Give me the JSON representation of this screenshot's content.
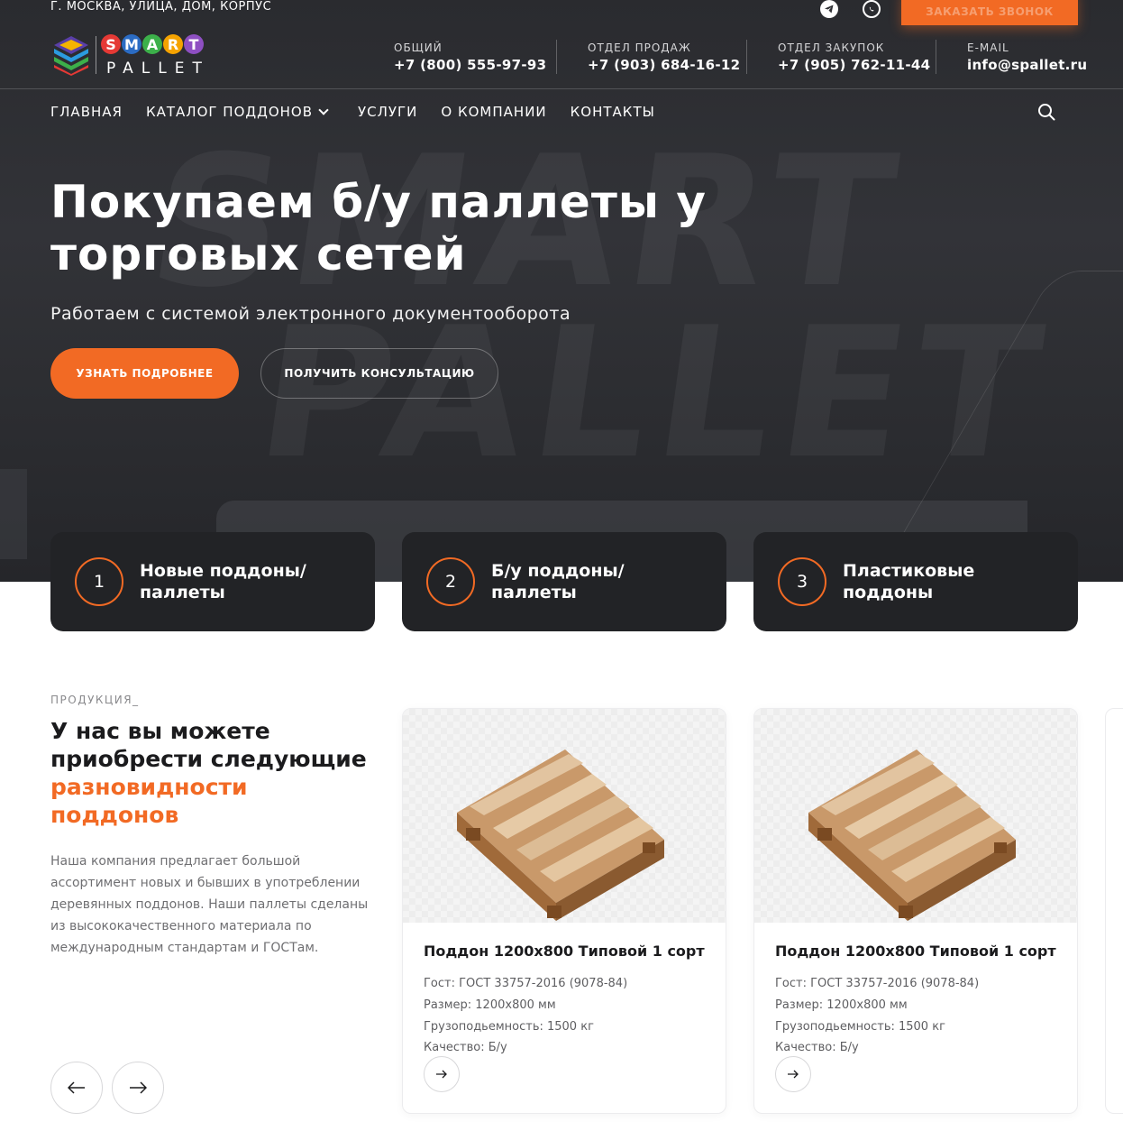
{
  "topbar": {
    "address": "Г. МОСКВА, УЛИЦА, ДОМ, КОРПУС",
    "callback_label": "ЗАКАЗАТЬ ЗВОНОК"
  },
  "logo": {
    "letters": [
      "S",
      "M",
      "A",
      "R",
      "T"
    ],
    "sub": "PALLET"
  },
  "contacts": [
    {
      "label": "ОБЩИЙ",
      "value": "+7 (800) 555-97-93"
    },
    {
      "label": "ОТДЕЛ ПРОДАЖ",
      "value": "+7 (903) 684-16-12"
    },
    {
      "label": "ОТДЕЛ ЗАКУПОК",
      "value": "+7 (905) 762-11-44"
    },
    {
      "label": "E-MAIL",
      "value": "info@spallet.ru"
    }
  ],
  "nav": {
    "items": [
      "ГЛАВНАЯ",
      "КАТАЛОГ ПОДДОНОВ",
      "УСЛУГИ",
      "О КОМПАНИИ",
      "КОНТАКТЫ"
    ]
  },
  "hero": {
    "title_bold": "Покупаем б/у",
    "title_rest": " паллеты у торговых сетей",
    "subtitle": "Работаем с системой электронного документооборота",
    "primary_button": "УЗНАТЬ ПОДРОБНЕЕ",
    "secondary_button": "ПОЛУЧИТЬ КОНСУЛЬТАЦИЮ",
    "watermark_top": "SMART",
    "watermark_bottom": "PALLET"
  },
  "categories": [
    {
      "num": "1",
      "label": "Новые поддоны/ паллеты"
    },
    {
      "num": "2",
      "label": "Б/у поддоны/ паллеты"
    },
    {
      "num": "3",
      "label": "Пластиковые поддоны"
    }
  ],
  "products_section": {
    "eyebrow": "ПРОДУКЦИЯ_",
    "title": "У нас вы можете приобрести следующие",
    "title_accent": "разновидности поддонов",
    "description": "Наша компания предлагает большой ассортимент новых и бывших в употреблении деревянных поддонов. Наши паллеты сделаны из высококачественного материала по международным стандартам и ГОСТам."
  },
  "products": [
    {
      "name": "Поддон 1200х800 Типовой 1 сорт",
      "gost": "Гост: ГОСТ 33757-2016 (9078-84)",
      "size": "Размер: 1200х800 мм",
      "capacity": "Грузоподьемность: 1500 кг",
      "quality": "Качество: Б/у"
    },
    {
      "name": "Поддон 1200х800 Типовой 1 сорт",
      "gost": "Гост: ГОСТ 33757-2016 (9078-84)",
      "size": "Размер: 1200х800 мм",
      "capacity": "Грузоподьемность: 1500 кг",
      "quality": "Качество: Б/у"
    }
  ],
  "colors": {
    "accent": "#f26a24",
    "dark_card": "#222326",
    "hero_bg": "#2e2f33"
  },
  "icons": {
    "telegram": "telegram-icon",
    "whatsapp": "whatsapp-icon",
    "search": "search-icon",
    "chevron": "chevron-down-icon",
    "arrow_left": "arrow-left-icon",
    "arrow_right": "arrow-right-icon"
  }
}
